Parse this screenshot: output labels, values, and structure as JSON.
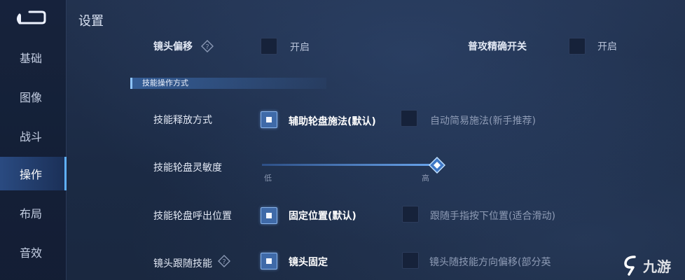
{
  "header": {
    "title": "设置"
  },
  "sidebar": {
    "items": [
      {
        "label": "基础",
        "active": false
      },
      {
        "label": "图像",
        "active": false
      },
      {
        "label": "战斗",
        "active": false
      },
      {
        "label": "操作",
        "active": true
      },
      {
        "label": "布局",
        "active": false
      },
      {
        "label": "音效",
        "active": false
      }
    ]
  },
  "top_row": {
    "camera_offset": {
      "label": "镜头偏移",
      "toggle_label": "开启",
      "checked": false
    },
    "precise_attack": {
      "label": "普攻精确开关",
      "toggle_label": "开启",
      "checked": false
    }
  },
  "section": {
    "title": "技能操作方式"
  },
  "skill_cast": {
    "label": "技能释放方式",
    "option1": "辅助轮盘施法(默认)",
    "option2": "自动简易施法(新手推荐)",
    "selected": 1
  },
  "wheel_sensitivity": {
    "label": "技能轮盘灵敏度",
    "min_label": "低",
    "max_label": "高",
    "value": 1.0
  },
  "wheel_position": {
    "label": "技能轮盘呼出位置",
    "option1": "固定位置(默认)",
    "option2": "跟随手指按下位置(适合滑动)",
    "selected": 1
  },
  "camera_follow": {
    "label": "镜头跟随技能",
    "option1": "镜头固定",
    "option2": "镜头随技能方向偏移(部分英",
    "selected": 1
  },
  "watermark": {
    "text": "九游"
  },
  "colors": {
    "accent": "#5fb0ff",
    "checked_fill": "#3f6aa8",
    "background": "#1d2b45"
  }
}
